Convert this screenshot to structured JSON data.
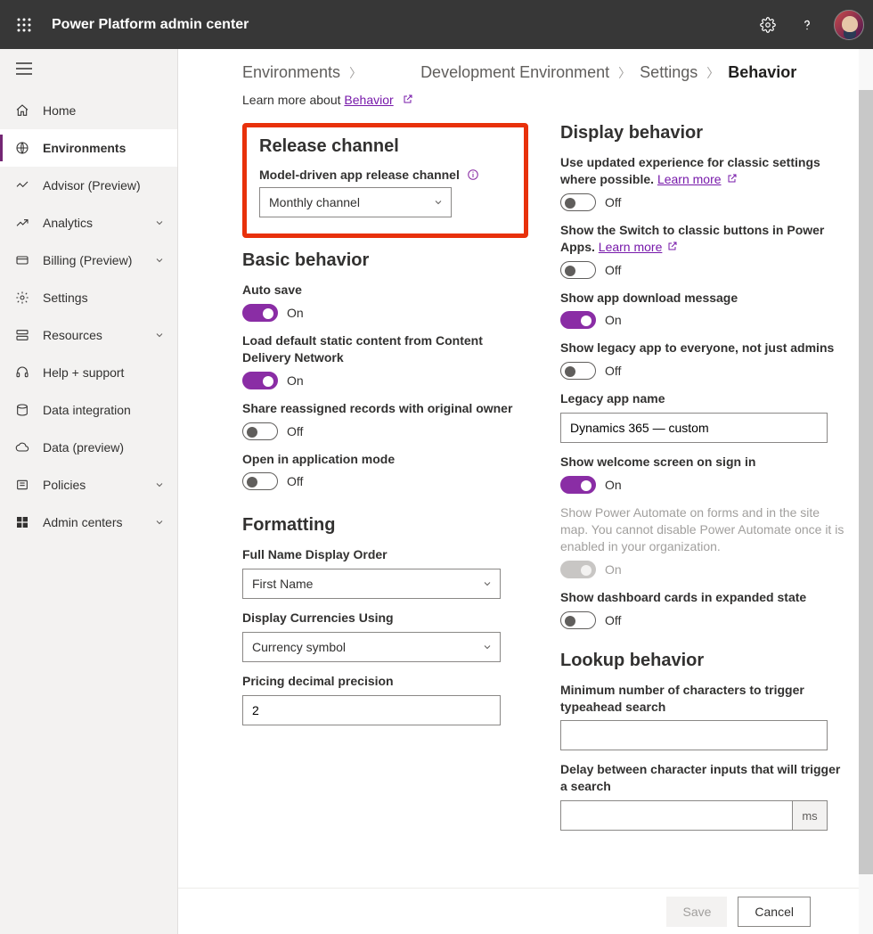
{
  "header": {
    "app_title": "Power Platform admin center"
  },
  "sidebar": {
    "items": [
      {
        "label": "Home"
      },
      {
        "label": "Environments"
      },
      {
        "label": "Advisor (Preview)"
      },
      {
        "label": "Analytics"
      },
      {
        "label": "Billing (Preview)"
      },
      {
        "label": "Settings"
      },
      {
        "label": "Resources"
      },
      {
        "label": "Help + support"
      },
      {
        "label": "Data integration"
      },
      {
        "label": "Data (preview)"
      },
      {
        "label": "Policies"
      },
      {
        "label": "Admin centers"
      }
    ]
  },
  "breadcrumb": {
    "items": [
      "Environments",
      "Development Environment",
      "Settings"
    ],
    "current": "Behavior"
  },
  "learn_more": {
    "prefix": "Learn more about ",
    "link": "Behavior"
  },
  "release": {
    "heading": "Release channel",
    "label": "Model-driven app release channel",
    "value": "Monthly channel"
  },
  "basic": {
    "heading": "Basic behavior",
    "auto_save": {
      "label": "Auto save",
      "state": "On",
      "on": true
    },
    "cdn": {
      "label": "Load default static content from Content Delivery Network",
      "state": "On",
      "on": true
    },
    "share_reassigned": {
      "label": "Share reassigned records with original owner",
      "state": "Off",
      "on": false
    },
    "app_mode": {
      "label": "Open in application mode",
      "state": "Off",
      "on": false
    }
  },
  "formatting": {
    "heading": "Formatting",
    "name_order": {
      "label": "Full Name Display Order",
      "value": "First Name"
    },
    "currency": {
      "label": "Display Currencies Using",
      "value": "Currency symbol"
    },
    "precision": {
      "label": "Pricing decimal precision",
      "value": "2"
    }
  },
  "display": {
    "heading": "Display behavior",
    "updated_exp": {
      "text": "Use updated experience for classic settings where possible. ",
      "link": "Learn more",
      "state": "Off",
      "on": false
    },
    "switch_classic": {
      "text": "Show the Switch to classic buttons in Power Apps. ",
      "link": "Learn more",
      "state": "Off",
      "on": false
    },
    "download": {
      "label": "Show app download message",
      "state": "On",
      "on": true
    },
    "legacy_everyone": {
      "label": "Show legacy app to everyone, not just admins",
      "state": "Off",
      "on": false
    },
    "legacy_name": {
      "label": "Legacy app name",
      "value": "Dynamics 365 — custom"
    },
    "welcome": {
      "label": "Show welcome screen on sign in",
      "state": "On",
      "on": true
    },
    "power_automate": {
      "text": "Show Power Automate on forms and in the site map. You cannot disable Power Automate once it is enabled in your organization.",
      "state": "On",
      "on": true,
      "disabled": true
    },
    "dashboard_expanded": {
      "label": "Show dashboard cards in expanded state",
      "state": "Off",
      "on": false
    }
  },
  "lookup": {
    "heading": "Lookup behavior",
    "min_chars": {
      "label": "Minimum number of characters to trigger typeahead search",
      "value": ""
    },
    "delay": {
      "label": "Delay between character inputs that will trigger a search",
      "value": "",
      "suffix": "ms"
    }
  },
  "footer": {
    "save": "Save",
    "cancel": "Cancel"
  }
}
